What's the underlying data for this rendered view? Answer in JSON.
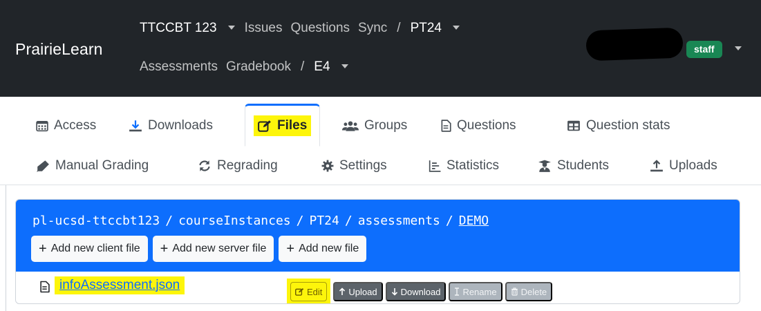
{
  "navbar": {
    "brand": "PrairieLearn",
    "course": "TTCCBT 123",
    "issues": "Issues",
    "questions": "Questions",
    "sync": "Sync",
    "slash": "/",
    "instance": "PT24",
    "assessments": "Assessments",
    "gradebook": "Gradebook",
    "assessment": "E4",
    "role_badge": "staff"
  },
  "tabs": {
    "access": "Access",
    "downloads": "Downloads",
    "files": "Files",
    "groups": "Groups",
    "questions": "Questions",
    "question_stats": "Question stats",
    "manual_grading": "Manual Grading",
    "regrading": "Regrading",
    "settings": "Settings",
    "statistics": "Statistics",
    "students": "Students",
    "uploads": "Uploads"
  },
  "file_browser": {
    "path": [
      "pl-ucsd-ttccbt123",
      "courseInstances",
      "PT24",
      "assessments"
    ],
    "current": "DEMO",
    "separator": "/",
    "buttons": {
      "add_client": "Add new client file",
      "add_server": "Add new server file",
      "add_file": "Add new file"
    },
    "files": [
      {
        "name": "infoAssessment.json",
        "actions": {
          "edit": "Edit",
          "upload": "Upload",
          "download": "Download",
          "rename": "Rename",
          "delete": "Delete"
        }
      }
    ]
  },
  "colors": {
    "navbar_bg": "#212529",
    "primary": "#0d6efd",
    "highlight": "#fdf50b",
    "staff_badge": "#198754"
  }
}
